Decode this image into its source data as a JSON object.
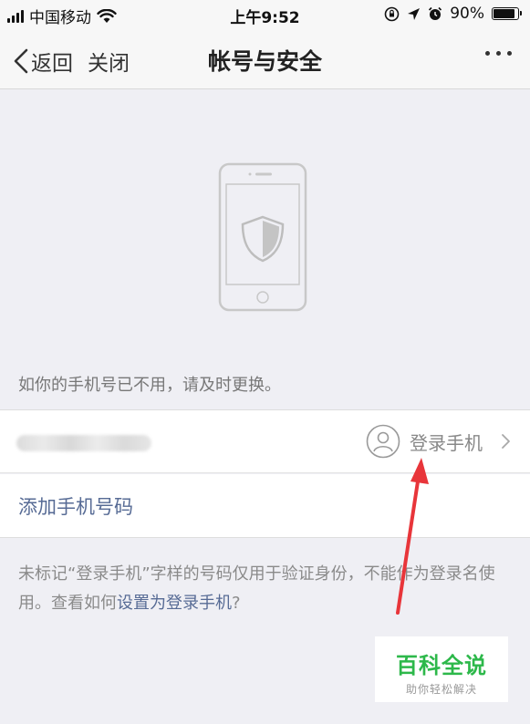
{
  "status_bar": {
    "carrier": "中国移动",
    "time": "上午9:52",
    "battery": "90%",
    "battery_level": 0.9
  },
  "nav": {
    "back_label": "返回",
    "close_label": "关闭",
    "title": "帐号与安全"
  },
  "hint": "如你的手机号已不用，请及时更换。",
  "phone_row": {
    "tag_label": "登录手机"
  },
  "add_row": {
    "label": "添加手机号码"
  },
  "note": {
    "text": "未标记“登录手机”字样的号码仅用于验证身份，不能作为登录名使用。查看如何",
    "link": "设置为登录手机",
    "suffix": "?"
  },
  "watermark": {
    "title": "百科全说",
    "subtitle": "助你轻松解决"
  },
  "colors": {
    "link": "#576b95",
    "annotation": "#e8353a",
    "watermark": "#2db84a"
  }
}
